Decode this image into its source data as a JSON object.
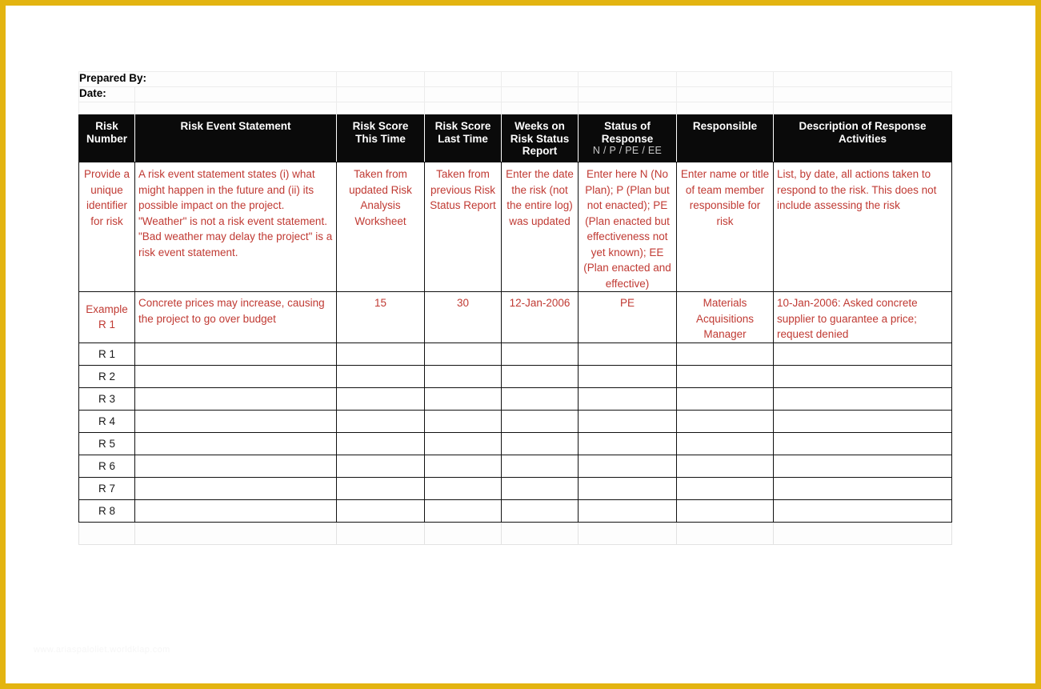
{
  "page": {
    "frame_color": "#e3b410",
    "accent_red": "#c03a33",
    "header_bg": "#0a0a0a",
    "watermark": "www.ariaspaloliet.worldklap.com"
  },
  "meta": {
    "prepared_by_label": "Prepared By:",
    "date_label": "Date:"
  },
  "table": {
    "headers": [
      {
        "line1": "Risk",
        "line2": "Number",
        "sub": ""
      },
      {
        "line1": "Risk Event Statement",
        "line2": "",
        "sub": ""
      },
      {
        "line1": "Risk Score",
        "line2": "This Time",
        "sub": ""
      },
      {
        "line1": "Risk Score",
        "line2": "Last Time",
        "sub": ""
      },
      {
        "line1": "Weeks on",
        "line2": "Risk Status Report",
        "sub": ""
      },
      {
        "line1": "Status of",
        "line2": "Response",
        "sub": "N / P / PE / EE"
      },
      {
        "line1": "Responsible",
        "line2": "",
        "sub": ""
      },
      {
        "line1": "Description of Response",
        "line2": "Activities",
        "sub": ""
      }
    ],
    "instruction_row": {
      "risk_number": "Provide a unique identifier for risk",
      "risk_event_statement": "A risk event statement states (i) what might happen in the future and (ii) its possible impact on the project. \"Weather\" is not a risk event statement. \"Bad weather may delay the project\" is a risk event statement.",
      "risk_score_this_time": "Taken from updated Risk Analysis Worksheet",
      "risk_score_last_time": "Taken from previous Risk Status Report",
      "weeks_on_report": "Enter the date the risk (not the entire log) was updated",
      "status_of_response": "Enter here N (No Plan); P (Plan but not enacted); PE (Plan enacted but effectiveness not yet known); EE (Plan enacted and effective)",
      "responsible": "Enter name or title of team member responsible for risk",
      "description_of_response": "List, by date, all actions taken to respond to the risk. This does not include assessing the risk"
    },
    "example_row": {
      "risk_number": "Example R 1",
      "risk_event_statement": "Concrete prices may increase, causing the project to go over budget",
      "risk_score_this_time": "15",
      "risk_score_last_time": "30",
      "weeks_on_report": "12-Jan-2006",
      "status_of_response": "PE",
      "responsible": "Materials Acquisitions Manager",
      "description_of_response": "10-Jan-2006: Asked concrete supplier to guarantee a price; request denied"
    },
    "blank_rows": [
      {
        "risk_number": "R 1"
      },
      {
        "risk_number": "R 2"
      },
      {
        "risk_number": "R 3"
      },
      {
        "risk_number": "R 4"
      },
      {
        "risk_number": "R 5"
      },
      {
        "risk_number": "R 6"
      },
      {
        "risk_number": "R 7"
      },
      {
        "risk_number": "R 8"
      }
    ]
  }
}
